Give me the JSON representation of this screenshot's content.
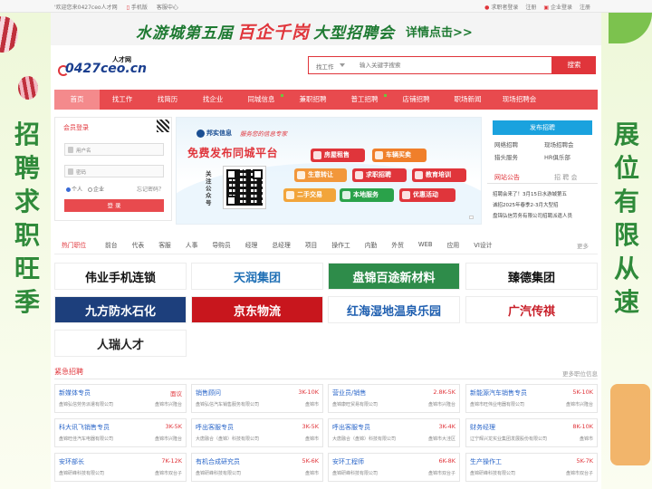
{
  "topbar": {
    "welcome": "'欢迎您来0427ceo人才网",
    "mobile": "手机版",
    "service": "客服中心",
    "seeker_login": "求职者登录",
    "seeker_register": "注册",
    "company_login": "企业登录",
    "company_register": "注册"
  },
  "slogan": {
    "prefix": "水游城第五届",
    "highlight": "百企千岗",
    "suffix": "大型招聘会",
    "detail": "详情点击>>"
  },
  "side": {
    "left": "招聘求职旺季",
    "right": "展位有限从速"
  },
  "logo": {
    "main": "0427ceo.cn",
    "small": "人才网"
  },
  "search": {
    "category": "找工作",
    "placeholder": "输入关键字搜索",
    "button": "搜索"
  },
  "nav": [
    {
      "label": "首页"
    },
    {
      "label": "找工作"
    },
    {
      "label": "找简历"
    },
    {
      "label": "找企业"
    },
    {
      "label": "同城信息"
    },
    {
      "label": "兼职招聘"
    },
    {
      "label": "普工招聘"
    },
    {
      "label": "店铺招聘"
    },
    {
      "label": "职场新闻"
    },
    {
      "label": "现场招聘会"
    }
  ],
  "login": {
    "title": "会员登录",
    "username_placeholder": "用户名",
    "password_placeholder": "密码",
    "radio_personal": "个人",
    "radio_company": "企业",
    "forgot": "忘记密码？",
    "button": "登 录"
  },
  "banner": {
    "brand": "邦实信息",
    "motto": "服务您的信息专家",
    "headline": "免费发布同城平台",
    "follow": "关注公众号",
    "pills": [
      "房屋租售",
      "车辆买卖",
      "生意转让",
      "求职招聘",
      "教育培训",
      "二手交易",
      "本地服务",
      "优惠活动"
    ]
  },
  "rpanel": {
    "post": "发布招聘",
    "links": [
      "网络招聘",
      "现场招聘会",
      "猎头服务",
      "HR俱乐部"
    ],
    "tab_notice": "网站公告",
    "tab_recruit": "招 聘 会",
    "news": [
      "招聘会来了！3月15日水游城第五",
      "诚招2025年春季2-3月大型招",
      "盘锦弘信劳务有限公司招聘派遣人员"
    ]
  },
  "hot": {
    "title": "热门职位",
    "keywords": [
      "前台",
      "代表",
      "客服",
      "人事",
      "导购员",
      "经理",
      "总经理",
      "项目",
      "操作工",
      "内勤",
      "外贸",
      "WEB",
      "应用",
      "VI设计"
    ],
    "more": "更多"
  },
  "logos": [
    {
      "name": "伟业手机连锁",
      "color": "#111111"
    },
    {
      "name": "天润集团",
      "color": "#1f6fb5"
    },
    {
      "name": "盘锦百途新材料",
      "color": "#ffffff"
    },
    {
      "name": "臻德集团",
      "color": "#111111"
    },
    {
      "name": "九方防水石化",
      "color": "#ffffff"
    },
    {
      "name": "京东物流",
      "color": "#ffffff"
    },
    {
      "name": "红海湿地温泉乐园",
      "color": "#1f5fb0"
    },
    {
      "name": "广汽传祺",
      "color": "#c81e28"
    },
    {
      "name": "人瑞人才",
      "color": "#222222"
    }
  ],
  "urgent": {
    "title": "紧急招聘",
    "more": "更多职位信息",
    "jobs": [
      {
        "title": "新媒体专员",
        "salary": "面议",
        "company": "盘锦弘信劳务派遣有限公司",
        "loc": "盘锦市兴隆台"
      },
      {
        "title": "销售顾问",
        "salary": "3K-10K",
        "company": "盘锦弘信汽车销售服务有限公司",
        "loc": "盘锦市"
      },
      {
        "title": "营业员/销售",
        "salary": "2.8K-5K",
        "company": "盘锦康旺贸易有限公司",
        "loc": "盘锦市兴隆台"
      },
      {
        "title": "新能源汽车销售专员",
        "salary": "5K-10K",
        "company": "盘锦市旺伟业电器有限公司",
        "loc": "盘锦市兴隆台"
      },
      {
        "title": "科大讯飞销售专员",
        "salary": "3K-5K",
        "company": "盘锦旺佳汽车电器有限公司",
        "loc": "盘锦市兴隆台"
      },
      {
        "title": "呼出客服专员",
        "salary": "3K-5K",
        "company": "大唐融合（盘锦）科技有限公司",
        "loc": "盘锦市"
      },
      {
        "title": "呼出客服专员",
        "salary": "3K-4K",
        "company": "大唐融合（盘锦）科技有限公司",
        "loc": "盘锦市大洼区"
      },
      {
        "title": "财务经理",
        "salary": "8K-10K",
        "company": "辽宁辉兴龙实业集团发展股份有限公司",
        "loc": "盘锦市"
      },
      {
        "title": "安环部长",
        "salary": "7K-12K",
        "company": "盘锦研峰科技有限公司",
        "loc": "盘锦市双台子"
      },
      {
        "title": "有机合成研究员",
        "salary": "5K-6K",
        "company": "盘锦研峰科技有限公司",
        "loc": "盘锦市"
      },
      {
        "title": "安环工程师",
        "salary": "6K-8K",
        "company": "盘锦研峰科技有限公司",
        "loc": "盘锦市双台子"
      },
      {
        "title": "生产操作工",
        "salary": "5K-7K",
        "company": "盘锦研峰科技有限公司",
        "loc": "盘锦市双台子"
      }
    ]
  },
  "colors": {
    "accent": "#e84a4e",
    "green": "#2f8a3a",
    "blue": "#1aa2de"
  }
}
